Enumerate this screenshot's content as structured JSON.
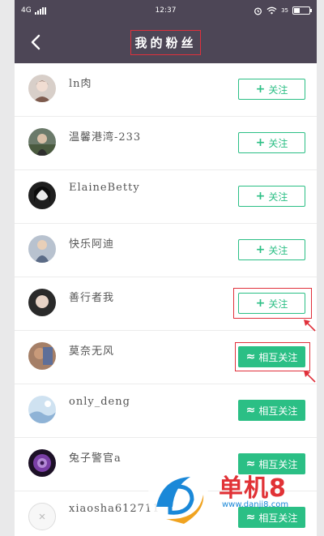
{
  "status_bar": {
    "network": "4G",
    "time": "12:37",
    "battery": "35"
  },
  "header": {
    "title": "我的粉丝"
  },
  "fans": [
    {
      "name": "ln肉",
      "button_label": "关注",
      "button_glyph": "+",
      "state": "follow"
    },
    {
      "name": "温馨港湾-233",
      "button_label": "关注",
      "button_glyph": "+",
      "state": "follow"
    },
    {
      "name": "ElaineBetty",
      "button_label": "关注",
      "button_glyph": "+",
      "state": "follow"
    },
    {
      "name": "快乐阿迪",
      "button_label": "关注",
      "button_glyph": "+",
      "state": "follow"
    },
    {
      "name": "善行者我",
      "button_label": "关注",
      "button_glyph": "+",
      "state": "follow"
    },
    {
      "name": "莫奈无风",
      "button_label": "相互关注",
      "button_glyph": "≈",
      "state": "mutual"
    },
    {
      "name": "only_deng",
      "button_label": "相互关注",
      "button_glyph": "≈",
      "state": "mutual"
    },
    {
      "name": "兔子警官a",
      "button_label": "相互关注",
      "button_glyph": "≈",
      "state": "mutual"
    },
    {
      "name": "xiaosha612711",
      "button_label": "相互关注",
      "button_glyph": "≈",
      "state": "mutual"
    }
  ],
  "watermark": {
    "brand": "单机8",
    "url": "www.danji8.com"
  },
  "colors": {
    "header_bg": "#4d4656",
    "accent_green": "#2bbf85",
    "highlight_red": "#e0303b"
  },
  "icons": {
    "back": "chevron-left-icon",
    "alarm": "alarm-icon",
    "wifi": "wifi-icon",
    "battery": "battery-icon"
  }
}
